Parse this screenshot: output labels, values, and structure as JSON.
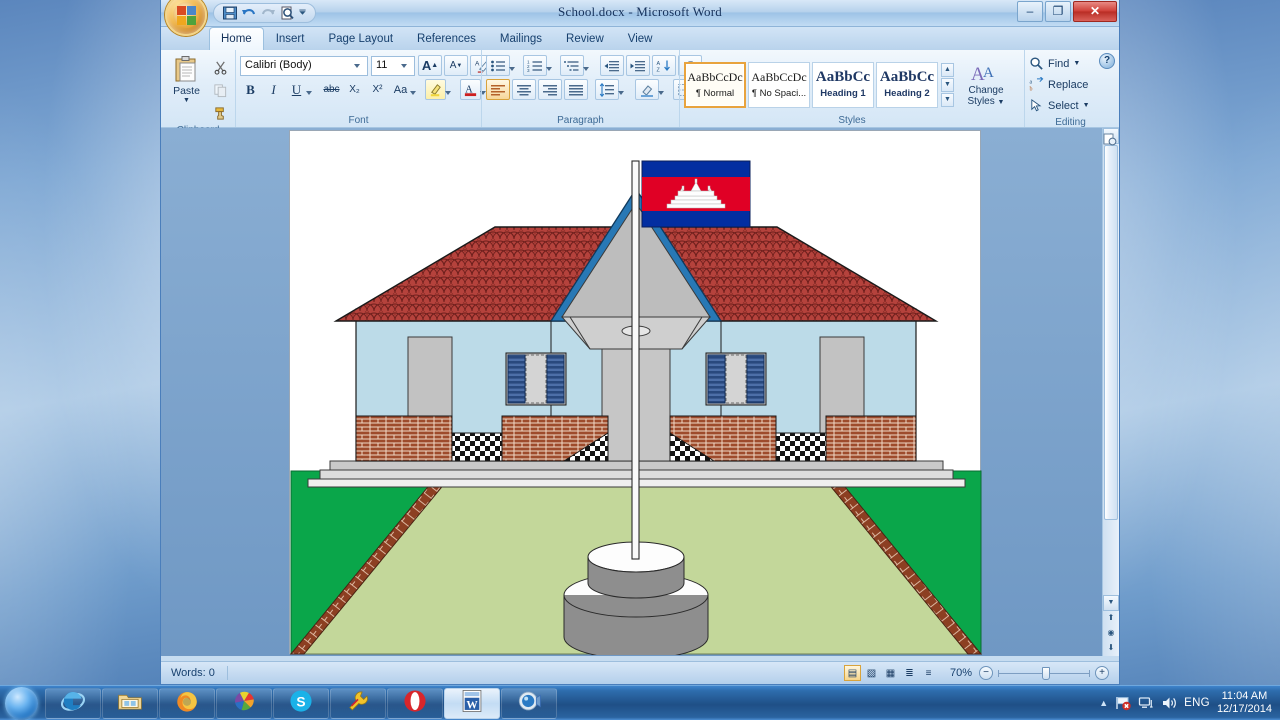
{
  "window": {
    "title": "School.docx - Microsoft Word",
    "minimize_label": "–",
    "restore_label": "❐",
    "close_label": "✕",
    "office_button": "office-orb",
    "help_label": "?"
  },
  "quick_access": [
    {
      "name": "save-icon",
      "glyph": "save"
    },
    {
      "name": "undo-icon",
      "glyph": "undo"
    },
    {
      "name": "redo-icon",
      "glyph": "redo"
    },
    {
      "name": "print-preview-icon",
      "glyph": "preview"
    },
    {
      "name": "customize-qat-icon",
      "glyph": "chevron"
    }
  ],
  "tabs": [
    {
      "label": "Home",
      "active": true
    },
    {
      "label": "Insert",
      "active": false
    },
    {
      "label": "Page Layout",
      "active": false
    },
    {
      "label": "References",
      "active": false
    },
    {
      "label": "Mailings",
      "active": false
    },
    {
      "label": "Review",
      "active": false
    },
    {
      "label": "View",
      "active": false
    }
  ],
  "ribbon": {
    "clipboard": {
      "label": "Clipboard",
      "paste_label": "Paste",
      "cut_label": "Cut",
      "copy_label": "Copy",
      "format_painter_label": "Format Painter"
    },
    "font": {
      "label": "Font",
      "font_name": "Calibri (Body)",
      "font_size": "11",
      "grow_font": "A",
      "shrink_font": "A",
      "clear_formatting": "Aa",
      "bold": "B",
      "italic": "I",
      "underline": "U",
      "strikethrough": "abc",
      "subscript": "X₂",
      "superscript": "X²",
      "change_case": "Aa",
      "highlight": "ab",
      "font_color": "A"
    },
    "paragraph": {
      "label": "Paragraph",
      "bullets": "bullets",
      "numbering": "numbering",
      "multilevel": "multilevel-list",
      "decrease_indent": "decrease-indent",
      "increase_indent": "increase-indent",
      "sort": "sort",
      "show_marks": "¶",
      "align_left": "align-left",
      "align_center": "align-center",
      "align_right": "align-right",
      "justify": "justify",
      "line_spacing": "line-spacing",
      "shading": "shading",
      "borders": "borders"
    },
    "styles": {
      "label": "Styles",
      "gallery": [
        {
          "preview": "AaBbCcDc",
          "name": "¶ Normal",
          "selected": true,
          "serif": false
        },
        {
          "preview": "AaBbCcDc",
          "name": "¶ No Spaci...",
          "selected": false,
          "serif": false
        },
        {
          "preview": "AaBbCс",
          "name": "Heading 1",
          "selected": false,
          "serif": true
        },
        {
          "preview": "AaBbCc",
          "name": "Heading 2",
          "selected": false,
          "serif": true
        }
      ],
      "change_styles_label": "Change",
      "change_styles_label2": "Styles"
    },
    "editing": {
      "label": "Editing",
      "find": "Find",
      "replace": "Replace",
      "select": "Select"
    }
  },
  "document": {
    "page_background": "#ffffff",
    "drawing": {
      "name": "school-building-illustration",
      "description": "Cambodian school building with flagpole",
      "colors": {
        "roof": "#b5423c",
        "wall": "#bcdbe8",
        "brick": "#9e4b2c",
        "grass_dark": "#0aa64a",
        "yard": "#c3d79a",
        "gray": "#c0c0c0",
        "flag_blue": "#032ea1",
        "flag_red": "#e00025",
        "gable_blue": "#2878b5"
      }
    }
  },
  "status_bar": {
    "words_label": "Words: 0",
    "zoom_value": "70%",
    "zoom_out": "−",
    "zoom_in": "+",
    "views": [
      {
        "name": "print-layout-view",
        "glyph": "▤",
        "active": true
      },
      {
        "name": "full-screen-reading-view",
        "glyph": "▧",
        "active": false
      },
      {
        "name": "web-layout-view",
        "glyph": "▦",
        "active": false
      },
      {
        "name": "outline-view",
        "glyph": "≣",
        "active": false
      },
      {
        "name": "draft-view",
        "glyph": "≡",
        "active": false
      }
    ]
  },
  "taskbar": {
    "start_label": "start-orb",
    "items": [
      {
        "name": "taskbar-internet-explorer",
        "icon": "internet-explorer-icon",
        "active": false
      },
      {
        "name": "taskbar-file-explorer",
        "icon": "file-explorer-icon",
        "active": false
      },
      {
        "name": "taskbar-firefox",
        "icon": "firefox-icon",
        "active": false
      },
      {
        "name": "taskbar-picasa",
        "icon": "picasa-icon",
        "active": false
      },
      {
        "name": "taskbar-skype",
        "icon": "skype-icon",
        "active": false
      },
      {
        "name": "taskbar-tool",
        "icon": "wrench-icon",
        "active": false
      },
      {
        "name": "taskbar-opera",
        "icon": "opera-icon",
        "active": false
      },
      {
        "name": "taskbar-word",
        "icon": "word-icon",
        "active": true
      },
      {
        "name": "taskbar-camera",
        "icon": "webcam-icon",
        "active": false
      }
    ],
    "tray": {
      "show_hidden": "▲",
      "action_center": "action-center-icon",
      "network": "network-icon",
      "volume": "volume-icon",
      "language": "ENG",
      "time": "11:04 AM",
      "date": "12/17/2014"
    }
  }
}
